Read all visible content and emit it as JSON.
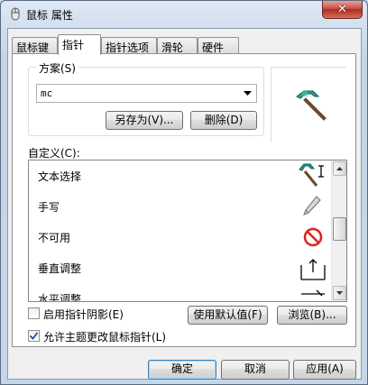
{
  "window": {
    "title": "鼠标 属性",
    "close_label": "✕"
  },
  "tabs": [
    {
      "label": "鼠标键",
      "active": false
    },
    {
      "label": "指针",
      "active": true
    },
    {
      "label": "指针选项",
      "active": false
    },
    {
      "label": "滑轮",
      "active": false
    },
    {
      "label": "硬件",
      "active": false
    }
  ],
  "scheme": {
    "legend": "方案(S)",
    "selected": "mc",
    "save_as_label": "另存为(V)...",
    "delete_label": "删除(D)"
  },
  "customize": {
    "label": "自定义(C):",
    "items": [
      {
        "label": "文本选择",
        "icon": "pickaxe-text-cursor-icon"
      },
      {
        "label": "手写",
        "icon": "pen-icon"
      },
      {
        "label": "不可用",
        "icon": "unavailable-icon"
      },
      {
        "label": "垂直调整",
        "icon": "vertical-resize-icon"
      },
      {
        "label": "水平调整",
        "icon": "horizontal-resize-icon"
      }
    ]
  },
  "options": {
    "shadow_label": "启用指针阴影(E)",
    "shadow_checked": false,
    "use_default_label": "使用默认值(F)",
    "browse_label": "浏览(B)...",
    "theme_label": "允许主题更改鼠标指针(L)",
    "theme_checked": true
  },
  "footer": {
    "ok_label": "确定",
    "cancel_label": "取消",
    "apply_label": "应用(A)"
  },
  "colors": {
    "pickaxe_head": "#2a9d8f",
    "pickaxe_handle": "#6b4a2b",
    "unavailable": "#e0201b"
  }
}
